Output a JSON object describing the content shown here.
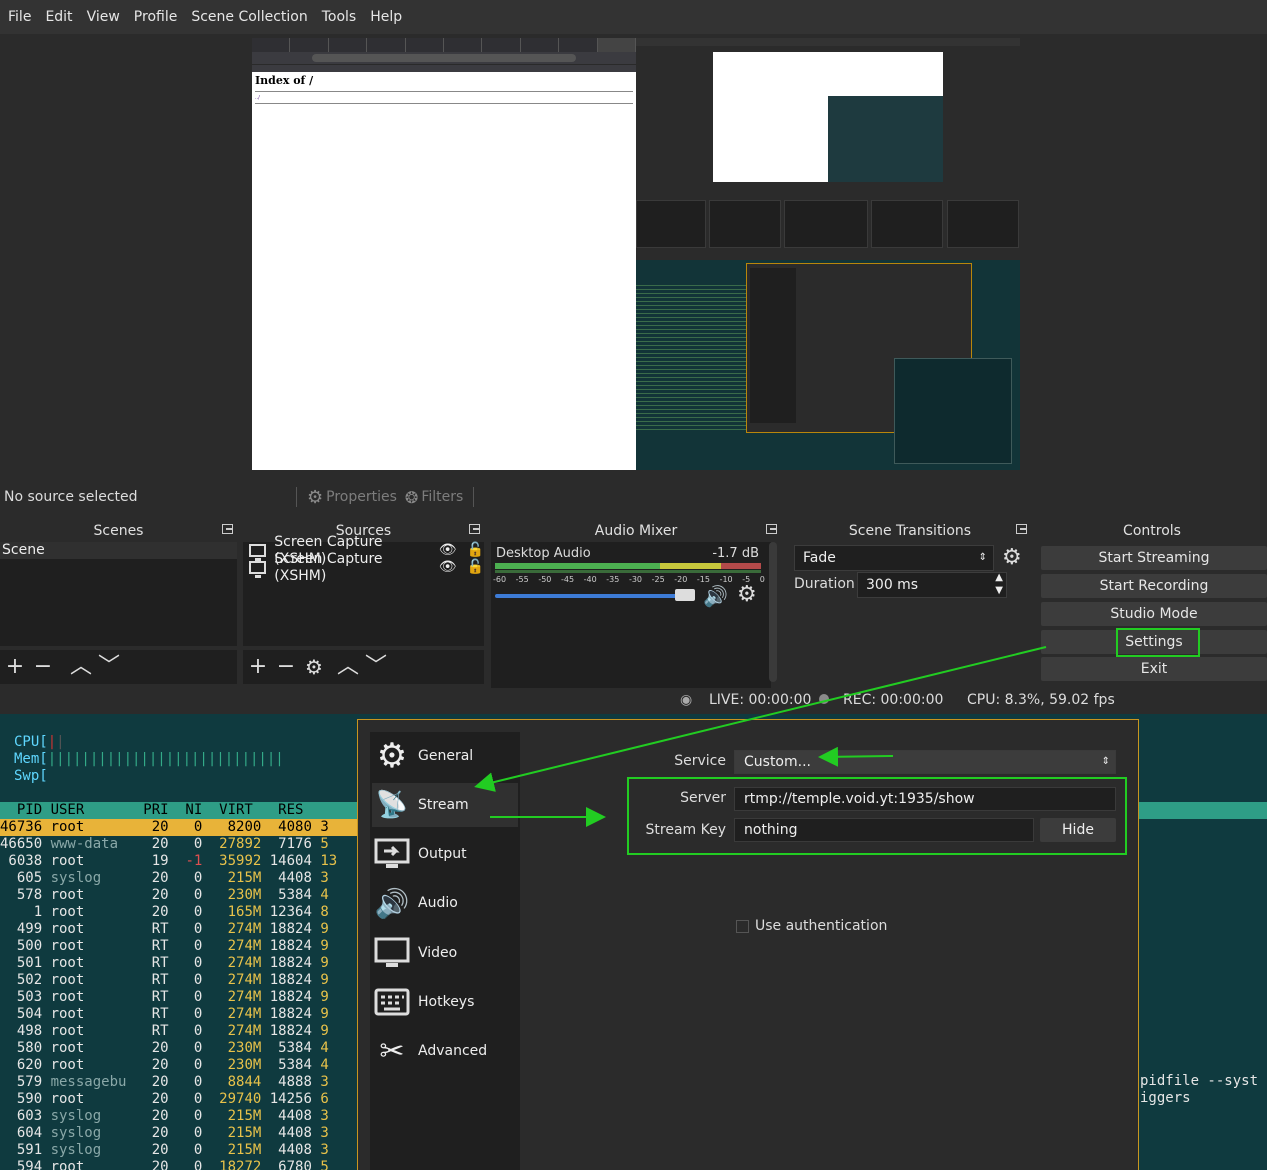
{
  "menu": [
    "File",
    "Edit",
    "View",
    "Profile",
    "Scene Collection",
    "Tools",
    "Help"
  ],
  "preview": {
    "browser_heading": "Index of /",
    "browser_link": "../"
  },
  "source_toolbar": {
    "no_source": "No source selected",
    "properties": "Properties",
    "filters": "Filters"
  },
  "scenes": {
    "title": "Scenes",
    "items": [
      "Scene"
    ]
  },
  "sources": {
    "title": "Sources",
    "items": [
      "Screen Capture (XSHM)",
      "Screen Capture (XSHM)"
    ]
  },
  "mixer": {
    "title": "Audio Mixer",
    "channel": "Desktop Audio",
    "level": "-1.7 dB",
    "ticks": [
      "-60",
      "-55",
      "-50",
      "-45",
      "-40",
      "-35",
      "-30",
      "-25",
      "-20",
      "-15",
      "-10",
      "-5",
      "0"
    ],
    "volume_fraction": 0.85
  },
  "transitions": {
    "title": "Scene Transitions",
    "selected": "Fade",
    "duration_label": "Duration",
    "duration_value": "300 ms"
  },
  "controls": {
    "title": "Controls",
    "buttons": [
      "Start Streaming",
      "Start Recording",
      "Studio Mode",
      "Settings",
      "Exit"
    ]
  },
  "status": {
    "live": "LIVE: 00:00:00",
    "rec": "REC: 00:00:00",
    "cpu": "CPU: 8.3%, 59.02 fps"
  },
  "terminal": {
    "meters": [
      "CPU[",
      "Mem[",
      "Swp["
    ],
    "header": "  PID USER       PRI  NI  VIRT   RES  ",
    "rows": [
      {
        "pid": "46736",
        "user": "root",
        "pri": "20",
        "ni": "0",
        "virt": "8200",
        "res": "4080",
        "tail": "3"
      },
      {
        "pid": "46650",
        "user": "www-data",
        "pri": "20",
        "ni": "0",
        "virt": "27892",
        "res": "7176",
        "tail": "5"
      },
      {
        "pid": "6038",
        "user": "root",
        "pri": "19",
        "ni": "-1",
        "virt": "35992",
        "res": "14604",
        "tail": "13"
      },
      {
        "pid": "605",
        "user": "syslog",
        "pri": "20",
        "ni": "0",
        "virt": "215M",
        "res": "4408",
        "tail": "3"
      },
      {
        "pid": "578",
        "user": "root",
        "pri": "20",
        "ni": "0",
        "virt": "230M",
        "res": "5384",
        "tail": "4"
      },
      {
        "pid": "1",
        "user": "root",
        "pri": "20",
        "ni": "0",
        "virt": "165M",
        "res": "12364",
        "tail": "8"
      },
      {
        "pid": "499",
        "user": "root",
        "pri": "RT",
        "ni": "0",
        "virt": "274M",
        "res": "18824",
        "tail": "9"
      },
      {
        "pid": "500",
        "user": "root",
        "pri": "RT",
        "ni": "0",
        "virt": "274M",
        "res": "18824",
        "tail": "9"
      },
      {
        "pid": "501",
        "user": "root",
        "pri": "RT",
        "ni": "0",
        "virt": "274M",
        "res": "18824",
        "tail": "9"
      },
      {
        "pid": "502",
        "user": "root",
        "pri": "RT",
        "ni": "0",
        "virt": "274M",
        "res": "18824",
        "tail": "9"
      },
      {
        "pid": "503",
        "user": "root",
        "pri": "RT",
        "ni": "0",
        "virt": "274M",
        "res": "18824",
        "tail": "9"
      },
      {
        "pid": "504",
        "user": "root",
        "pri": "RT",
        "ni": "0",
        "virt": "274M",
        "res": "18824",
        "tail": "9"
      },
      {
        "pid": "498",
        "user": "root",
        "pri": "RT",
        "ni": "0",
        "virt": "274M",
        "res": "18824",
        "tail": "9"
      },
      {
        "pid": "580",
        "user": "root",
        "pri": "20",
        "ni": "0",
        "virt": "230M",
        "res": "5384",
        "tail": "4"
      },
      {
        "pid": "620",
        "user": "root",
        "pri": "20",
        "ni": "0",
        "virt": "230M",
        "res": "5384",
        "tail": "4"
      },
      {
        "pid": "579",
        "user": "messagebu",
        "pri": "20",
        "ni": "0",
        "virt": "8844",
        "res": "4888",
        "tail": "3"
      },
      {
        "pid": "590",
        "user": "root",
        "pri": "20",
        "ni": "0",
        "virt": "29740",
        "res": "14256",
        "tail": "6"
      },
      {
        "pid": "603",
        "user": "syslog",
        "pri": "20",
        "ni": "0",
        "virt": "215M",
        "res": "4408",
        "tail": "3"
      },
      {
        "pid": "604",
        "user": "syslog",
        "pri": "20",
        "ni": "0",
        "virt": "215M",
        "res": "4408",
        "tail": "3"
      },
      {
        "pid": "591",
        "user": "syslog",
        "pri": "20",
        "ni": "0",
        "virt": "215M",
        "res": "4408",
        "tail": "3"
      },
      {
        "pid": "594",
        "user": "root",
        "pri": "20",
        "ni": "0",
        "virt": "18272",
        "res": "6780",
        "tail": "5"
      }
    ],
    "cmd_right": [
      "pidfile --syst",
      "iggers"
    ]
  },
  "settings": {
    "nav": [
      "General",
      "Stream",
      "Output",
      "Audio",
      "Video",
      "Hotkeys",
      "Advanced"
    ],
    "service_label": "Service",
    "service_value": "Custom...",
    "server_label": "Server",
    "server_value": "rtmp://temple.void.yt:1935/show",
    "key_label": "Stream Key",
    "key_value": "nothing",
    "hide_button": "Hide",
    "use_auth": "Use authentication"
  },
  "annotation_color": "#22cc22"
}
